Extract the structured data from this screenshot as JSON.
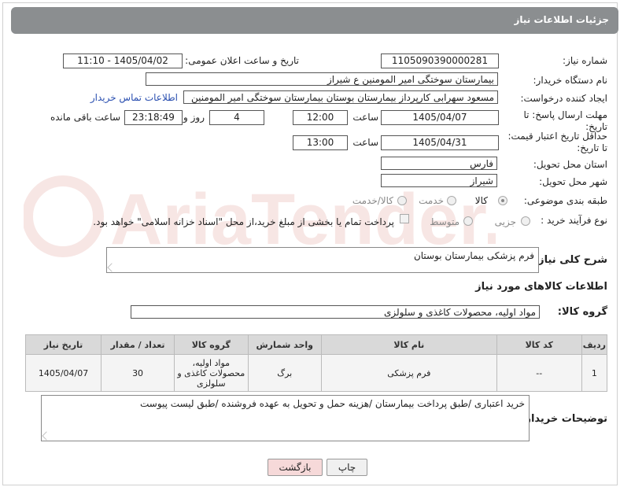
{
  "header": {
    "title": "جزئیات اطلاعات نیاز"
  },
  "form": {
    "need_number_label": "شماره نیاز:",
    "need_number": "1105090390000281",
    "announce_label": "تاریخ و ساعت اعلان عمومی:",
    "announce_value": "1405/04/02 - 11:10",
    "buyer_org_label": "نام دستگاه خریدار:",
    "buyer_org": "بیمارستان سوختگی امیر المومنین  ع  شیراز",
    "requester_label": "ایجاد کننده درخواست:",
    "requester": "مسعود سهرابی کارپرداز بیمارستان بوستان بیمارستان سوختگی امیر المومنین",
    "contact_link": "اطلاعات تماس خریدار",
    "reply_deadline_label": "مهلت ارسال پاسخ: تا تاریخ:",
    "reply_date": "1405/04/07",
    "time_label": "ساعت",
    "reply_time": "12:00",
    "days_value": "4",
    "days_label": "روز و",
    "remaining_time": "23:18:49",
    "remaining_label": "ساعت باقی مانده",
    "price_validity_label": "حداقل تاریخ اعتبار قیمت: تا تاریخ:",
    "price_date": "1405/04/31",
    "price_time": "13:00",
    "province_label": "استان محل تحویل:",
    "province": "فارس",
    "city_label": "شهر محل تحویل:",
    "city": "شیراز",
    "category_label": "طبقه بندی موضوعی:",
    "category_options": [
      "کالا",
      "خدمت",
      "کالا/خدمت"
    ],
    "process_label": "نوع فرآیند خرید :",
    "process_options": [
      "جزیی",
      "متوسط"
    ],
    "payment_note": "پرداخت تمام یا بخشی از مبلغ خرید،از محل \"اسناد خزانه اسلامی\" خواهد بود."
  },
  "description": {
    "label": "شرح کلی نیاز:",
    "text": "فرم پزشکی بیمارستان بوستان"
  },
  "goods_info": {
    "title": "اطلاعات کالاهای مورد نیاز",
    "group_label": "گروه کالا:",
    "group_value": "مواد اولیه، محصولات کاغذی و سلولزی"
  },
  "table": {
    "headers": [
      "ردیف",
      "کد کالا",
      "نام کالا",
      "واحد شمارش",
      "گروه کالا",
      "تعداد / مقدار",
      "تاریخ نیاز"
    ],
    "row": {
      "index": "1",
      "code": "--",
      "name": "فرم پزشکی",
      "unit": "برگ",
      "group": "مواد اولیه، محصولات کاغذی و سلولزی",
      "qty": "30",
      "date": "1405/04/07"
    }
  },
  "buyer_notes": {
    "label": "توضیحات خریدار:",
    "text": "خرید اعتباری /طبق پرداخت بیمارستان /هزینه حمل و تحویل به عهده فروشنده /طبق لیست پیوست"
  },
  "buttons": {
    "print": "چاپ",
    "back": "بازگشت"
  },
  "watermark": "AriaTender.net",
  "colors": {
    "header_bg": "#8b8e90",
    "link": "#2a4fb0",
    "back_btn_bg": "#f6d9d9",
    "watermark": "#c0392b"
  }
}
